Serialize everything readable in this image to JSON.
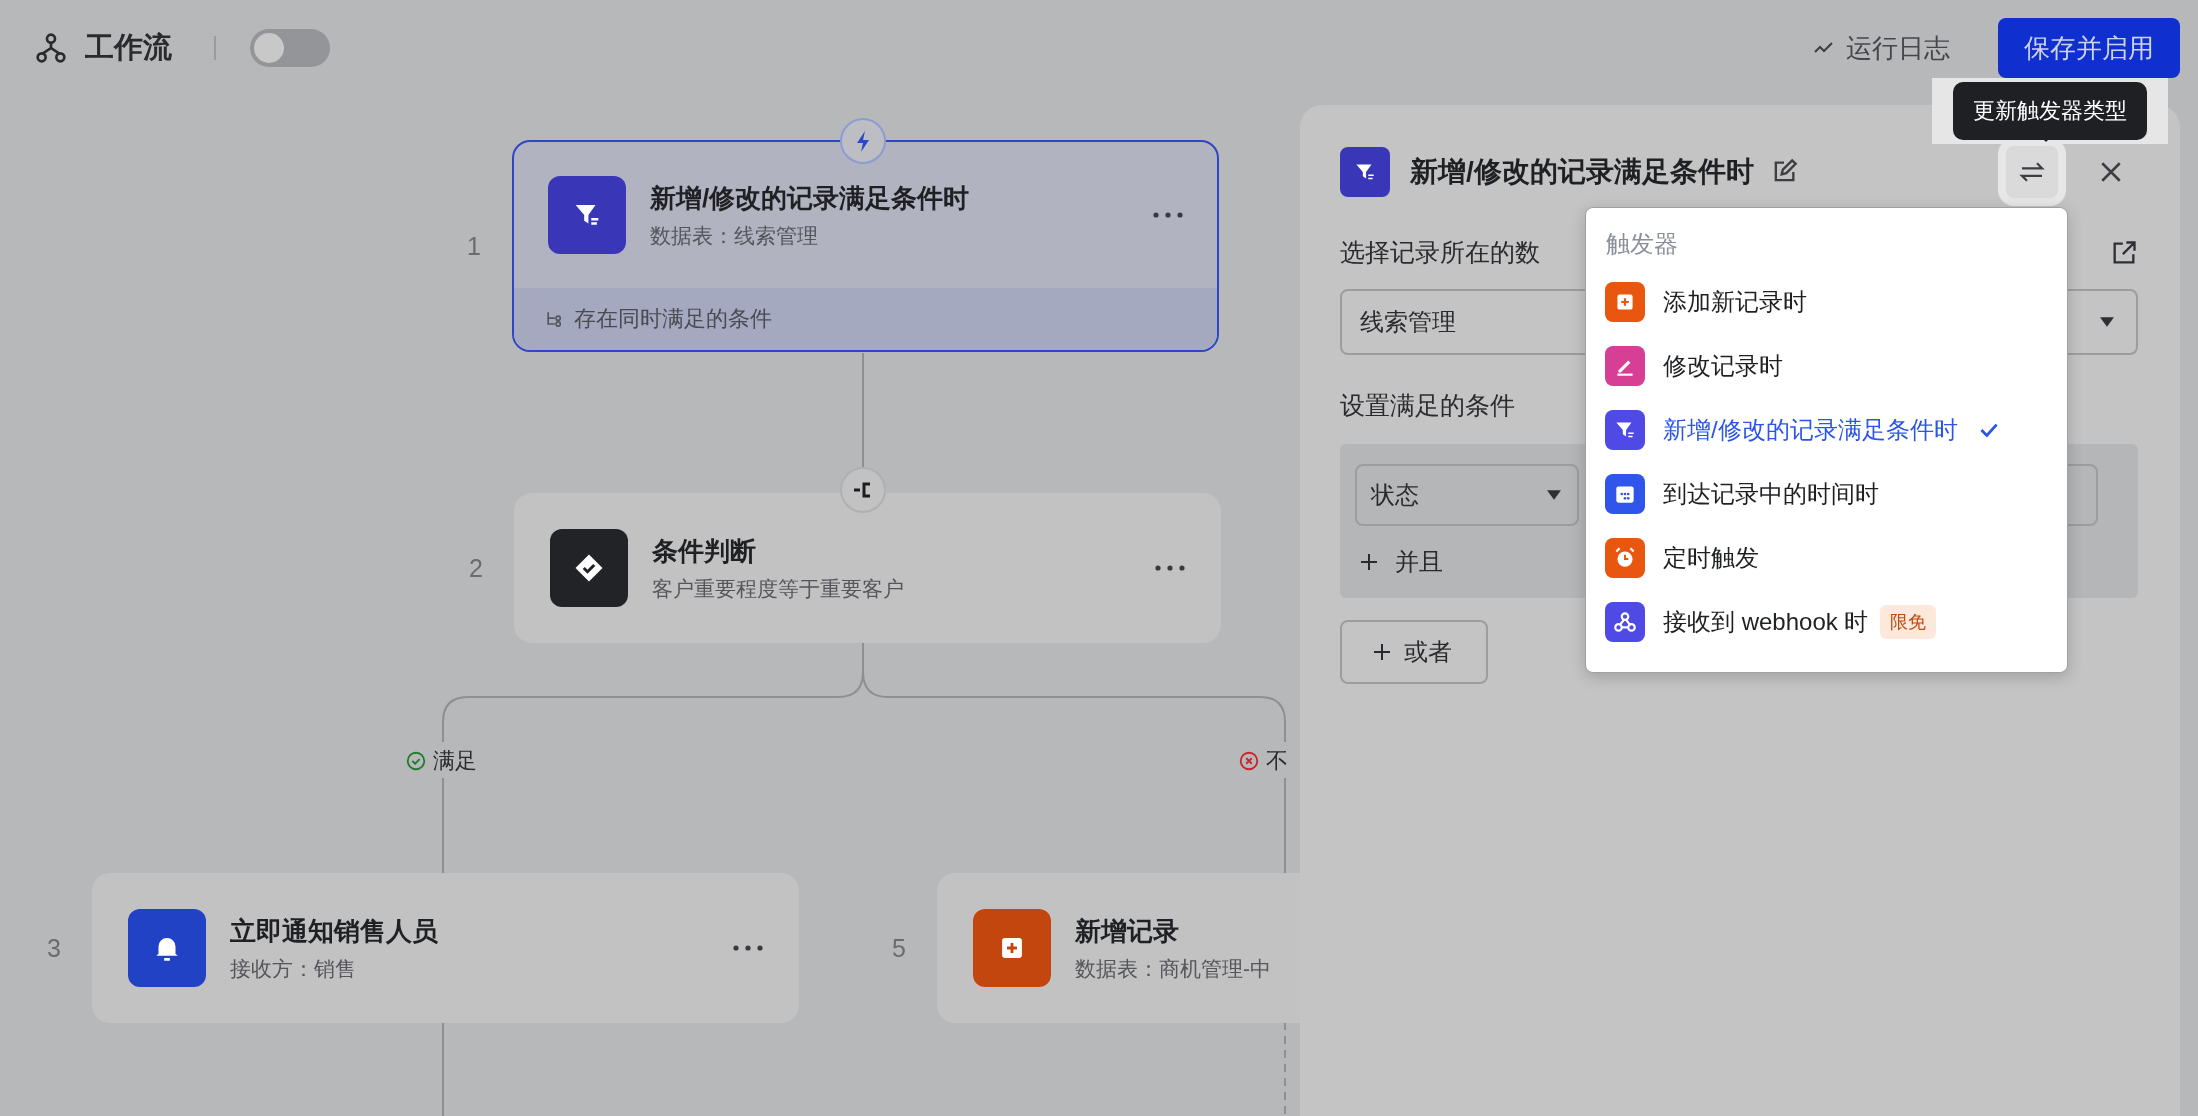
{
  "header": {
    "title": "工作流",
    "enabled": false,
    "run_log": "运行日志",
    "save_button": "保存并启用"
  },
  "canvas": {
    "nodes": [
      {
        "number": "1",
        "kind": "trigger",
        "title": "新增/修改的记录满足条件时",
        "subtitle": "数据表：线索管理",
        "footer": "存在同时满足的条件",
        "selected": true
      },
      {
        "number": "2",
        "kind": "condition",
        "title": "条件判断",
        "subtitle": "客户重要程度等于重要客户",
        "selected": false
      },
      {
        "number": "3",
        "kind": "notify",
        "title": "立即通知销售人员",
        "subtitle": "接收方：销售",
        "selected": false
      },
      {
        "number": "5",
        "kind": "add",
        "title": "新增记录",
        "subtitle": "数据表：商机管理-中",
        "selected": false
      }
    ],
    "branches": [
      {
        "kind": "yes",
        "label": "满足"
      },
      {
        "kind": "no",
        "label": "不"
      }
    ]
  },
  "panel": {
    "title": "新增/修改的记录满足条件时",
    "table_label": "选择记录所在的数",
    "table_value": "线索管理",
    "conditions_label": "设置满足的条件",
    "condition_field": "状态",
    "and_button": "并且",
    "or_button": "或者"
  },
  "tooltip": "更新触发器类型",
  "trigger_menu": {
    "heading": "触发器",
    "items": [
      {
        "kind": "add",
        "label": "添加新记录时",
        "color": "#e8560f",
        "selected": false
      },
      {
        "kind": "edit",
        "label": "修改记录时",
        "color": "#d63f93",
        "selected": false
      },
      {
        "kind": "filter",
        "label": "新增/修改的记录满足条件时",
        "color": "#4f49e6",
        "selected": true
      },
      {
        "kind": "calendar",
        "label": "到达记录中的时间时",
        "color": "#2f55eb",
        "selected": false
      },
      {
        "kind": "alarm",
        "label": "定时触发",
        "color": "#e8560f",
        "selected": false
      },
      {
        "kind": "webhook",
        "label": "接收到 webhook 时",
        "color": "#4f49e6",
        "selected": false,
        "badge": "限免"
      }
    ]
  }
}
